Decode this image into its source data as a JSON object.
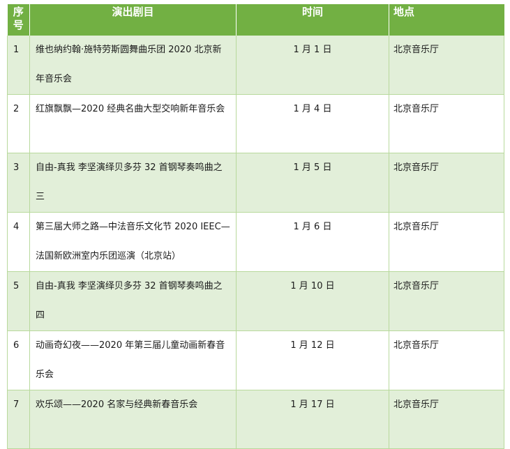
{
  "headers": {
    "no": "序\n号",
    "program": "演出剧目",
    "time": "时间",
    "place": "地点"
  },
  "rows": [
    {
      "no": "1",
      "program": "维也纳约翰·施特劳斯圆舞曲乐团 2020 北京新年音乐会",
      "time": "1 月 1 日",
      "place": "北京音乐厅"
    },
    {
      "no": "2",
      "program": "红旗飘飘—2020 经典名曲大型交响新年音乐会",
      "time": "1 月 4 日",
      "place": "北京音乐厅"
    },
    {
      "no": "3",
      "program": "自由-真我 李坚演绎贝多芬 32 首钢琴奏鸣曲之三",
      "time": "1 月 5 日",
      "place": "北京音乐厅"
    },
    {
      "no": "4",
      "program": "第三届大师之路—中法音乐文化节 2020 IEEC—法国新欧洲室内乐团巡演（北京站）",
      "time": "1 月 6 日",
      "place": "北京音乐厅"
    },
    {
      "no": "5",
      "program": "自由-真我 李坚演绎贝多芬 32 首钢琴奏鸣曲之四",
      "time": "1 月 10 日",
      "place": "北京音乐厅"
    },
    {
      "no": "6",
      "program": "动画奇幻夜——2020 年第三届儿童动画新春音乐会",
      "time": "1 月 12 日",
      "place": "北京音乐厅"
    },
    {
      "no": "7",
      "program": "欢乐颂——2020 名家与经典新春音乐会",
      "time": "1 月 17 日",
      "place": "北京音乐厅"
    }
  ]
}
